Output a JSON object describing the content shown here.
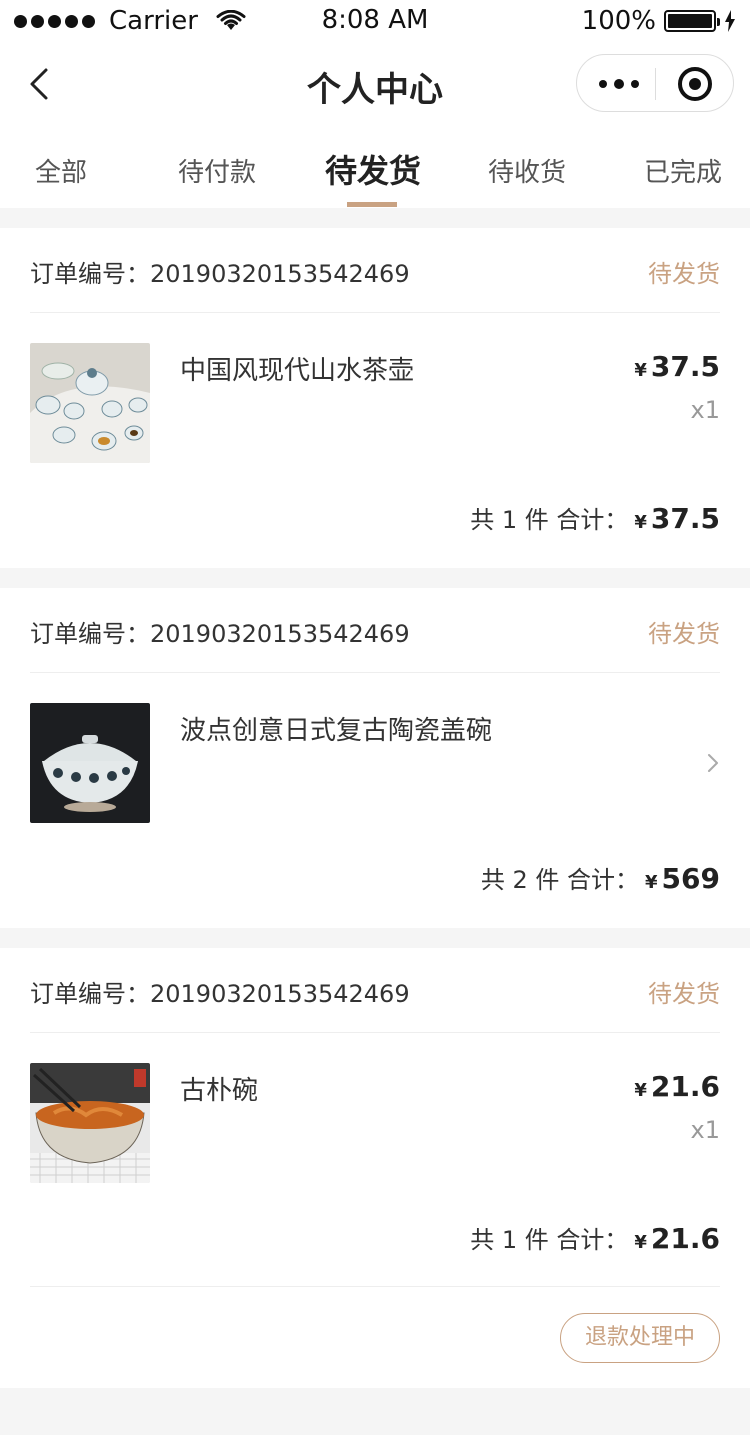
{
  "status_bar": {
    "carrier": "Carrier",
    "time": "8:08 AM",
    "battery": "100%"
  },
  "nav": {
    "title": "个人中心"
  },
  "tabs": [
    {
      "label": "全部",
      "active": false
    },
    {
      "label": "待付款",
      "active": false
    },
    {
      "label": "待发货",
      "active": true
    },
    {
      "label": "待收货",
      "active": false
    },
    {
      "label": "已完成",
      "active": false
    }
  ],
  "colors": {
    "accent": "#c9a282",
    "background": "#f5f5f5",
    "text": "#333333"
  },
  "orders": [
    {
      "order_no_label": "订单编号：",
      "order_no": "20190320153542469",
      "status": "待发货",
      "product_name": "中国风现代山水茶壶",
      "currency": "¥",
      "price": "37.5",
      "qty": "x1",
      "count_text": "共 1 件 合计：",
      "total": "37.5"
    },
    {
      "order_no_label": "订单编号：",
      "order_no": "20190320153542469",
      "status": "待发货",
      "product_name": "波点创意日式复古陶瓷盖碗",
      "currency": "¥",
      "count_text": "共 2 件 合计：",
      "total": "569"
    },
    {
      "order_no_label": "订单编号：",
      "order_no": "20190320153542469",
      "status": "待发货",
      "product_name": "古朴碗",
      "currency": "¥",
      "price": "21.6",
      "qty": "x1",
      "count_text": "共 1 件 合计：",
      "total": "21.6",
      "action_label": "退款处理中"
    }
  ]
}
